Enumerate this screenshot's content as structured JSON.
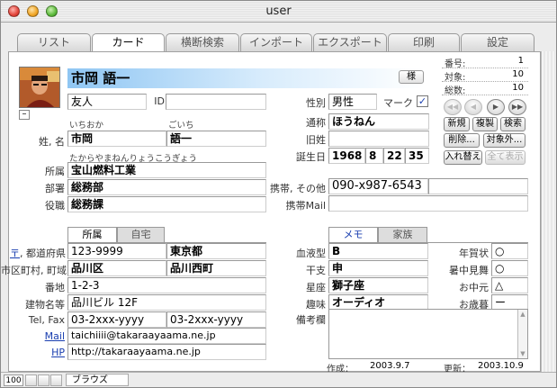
{
  "window": {
    "title": "user"
  },
  "tabs": [
    "リスト",
    "カード",
    "横断検索",
    "インポート",
    "エクスポート",
    "印刷",
    "設定"
  ],
  "active_tab": 1,
  "record": {
    "number_label": "番号:",
    "number": "1",
    "found_label": "対象:",
    "found": "10",
    "total_label": "総数:",
    "total": "10"
  },
  "nav_buttons": [
    "first",
    "prev",
    "next",
    "last"
  ],
  "menu_buttons": {
    "new": "新規",
    "duplicate": "複製",
    "search": "検索",
    "delete": "削除...",
    "omit": "対象外...",
    "swap": "入れ替え",
    "show_all": "全て表示"
  },
  "header": {
    "full_name": "市岡 語一",
    "sama": "様"
  },
  "relation": {
    "value": "友人",
    "id_label": "ID",
    "id_value": ""
  },
  "gender": {
    "label": "性別",
    "value": "男性",
    "mark_label": "マーク",
    "mark_checked": "✓"
  },
  "nickname": {
    "label": "通称",
    "value": "ほうねん"
  },
  "former_name": {
    "label": "旧姓",
    "value": ""
  },
  "birthday": {
    "label": "誕生日",
    "year": "1968",
    "month": "8",
    "day": "22",
    "age": "35"
  },
  "name": {
    "label": "姓, 名",
    "last_kana": "いちおか",
    "first_kana": "ごいち",
    "last": "市岡",
    "first": "語一"
  },
  "company": {
    "kana": "たからやまねんりょうこうぎょう",
    "label": "所属",
    "value": "宝山燃料工業",
    "dept_label": "部署",
    "dept": "総務部",
    "title_label": "役職",
    "title": "総務課"
  },
  "mobile": {
    "phone_label": "携帯, その他",
    "phone": "090-x987-6543",
    "other": "",
    "mail_label": "携帯Mail",
    "mail": ""
  },
  "address_tabs": [
    "所属",
    "自宅"
  ],
  "address": {
    "zip_label": "〒",
    "pref_label": ", 都道府県",
    "zip": "123-9999",
    "pref": "東京都",
    "city_label": "市区町村, 町域",
    "city": "品川区",
    "town": "品川西町",
    "number_label": "番地",
    "number": "1-2-3",
    "building_label": "建物名等",
    "building": "品川ビル 12F",
    "telfax_label": "Tel, Fax",
    "tel": "03-2xxx-yyyy",
    "fax": "03-2xxx-yyyy",
    "mail_label": "Mail",
    "mail": "taichiiii@takaraayaama.ne.jp",
    "hp_label": "HP",
    "hp": "http://takaraayaama.ne.jp"
  },
  "memo_tabs": [
    "メモ",
    "家族"
  ],
  "memo": {
    "blood_label": "血液型",
    "blood": "B",
    "eto_label": "干支",
    "eto": "申",
    "sign_label": "星座",
    "sign": "獅子座",
    "hobby_label": "趣味",
    "hobby": "オーディオ",
    "notes_label": "備考欄",
    "notes": "",
    "nengajo_label": "年賀状",
    "nengajo": "○",
    "shochu_label": "暑中見舞",
    "shochu": "○",
    "ochugen_label": "お中元",
    "ochugen": "△",
    "oseibo_label": "お歳暮",
    "oseibo": "ー"
  },
  "footer": {
    "created_label": "作成：",
    "created": "2003.9.7",
    "updated_label": "更新：",
    "updated": "2003.10.9"
  },
  "status": {
    "zoom": "100",
    "mode": "ブラウズ"
  }
}
